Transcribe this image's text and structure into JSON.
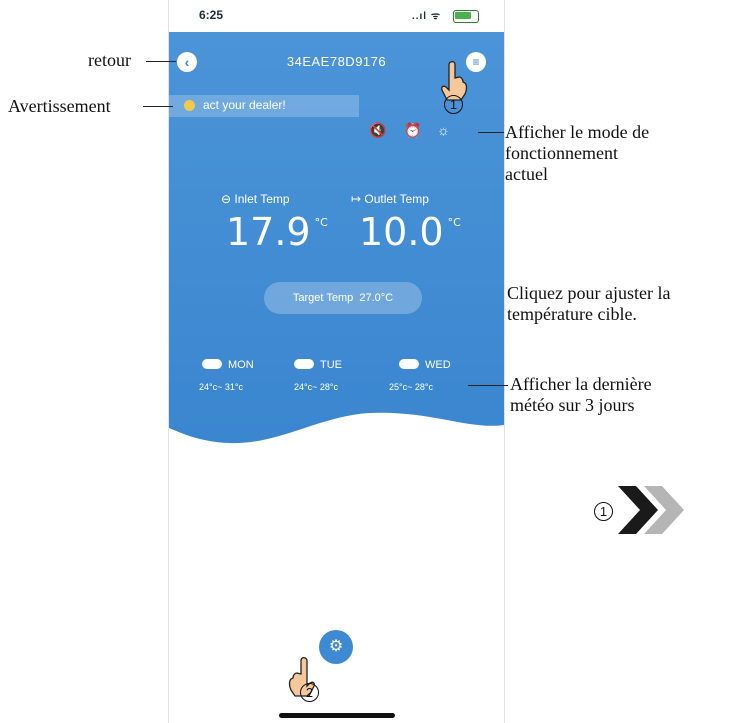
{
  "status_bar": {
    "time": "6:25",
    "signal": "..ıl ᯤ"
  },
  "header": {
    "device_id": "34EAE78D9176",
    "back_icon": "chevron-left-icon",
    "menu_icon": "menu-icon"
  },
  "alert": {
    "text": "act your dealer!"
  },
  "mode_icons": {
    "mute": "🔇",
    "alarm": "⏰",
    "sun": "☼"
  },
  "temps": {
    "inlet_label": "Inlet Temp",
    "inlet_value": "17.9",
    "inlet_unit": "°C",
    "outlet_label": "Outlet Temp",
    "outlet_value": "10.0",
    "outlet_unit": "°C"
  },
  "target": {
    "label": "Target Temp",
    "value": "27.0",
    "unit": "°C"
  },
  "forecast": [
    {
      "day": "MON",
      "range": "24°c~ 31°c"
    },
    {
      "day": "TUE",
      "range": "24°c~ 28°c"
    },
    {
      "day": "WED",
      "range": "25°c~ 28°c"
    }
  ],
  "markers": {
    "one": "1",
    "two": "2"
  },
  "annotations": {
    "retour": "retour",
    "avertissement": "Avertissement",
    "mode_l1": "Afficher le mode de",
    "mode_l2": "fonctionnement",
    "mode_l3": "actuel",
    "target_l1": "Cliquez pour ajuster la",
    "target_l2": "température cible.",
    "weather_l1": "Afficher la dernière",
    "weather_l2": "météo sur 3 jours"
  },
  "colors": {
    "sky_blue": "#3d8ad3",
    "accent": "#3e8ad2"
  }
}
